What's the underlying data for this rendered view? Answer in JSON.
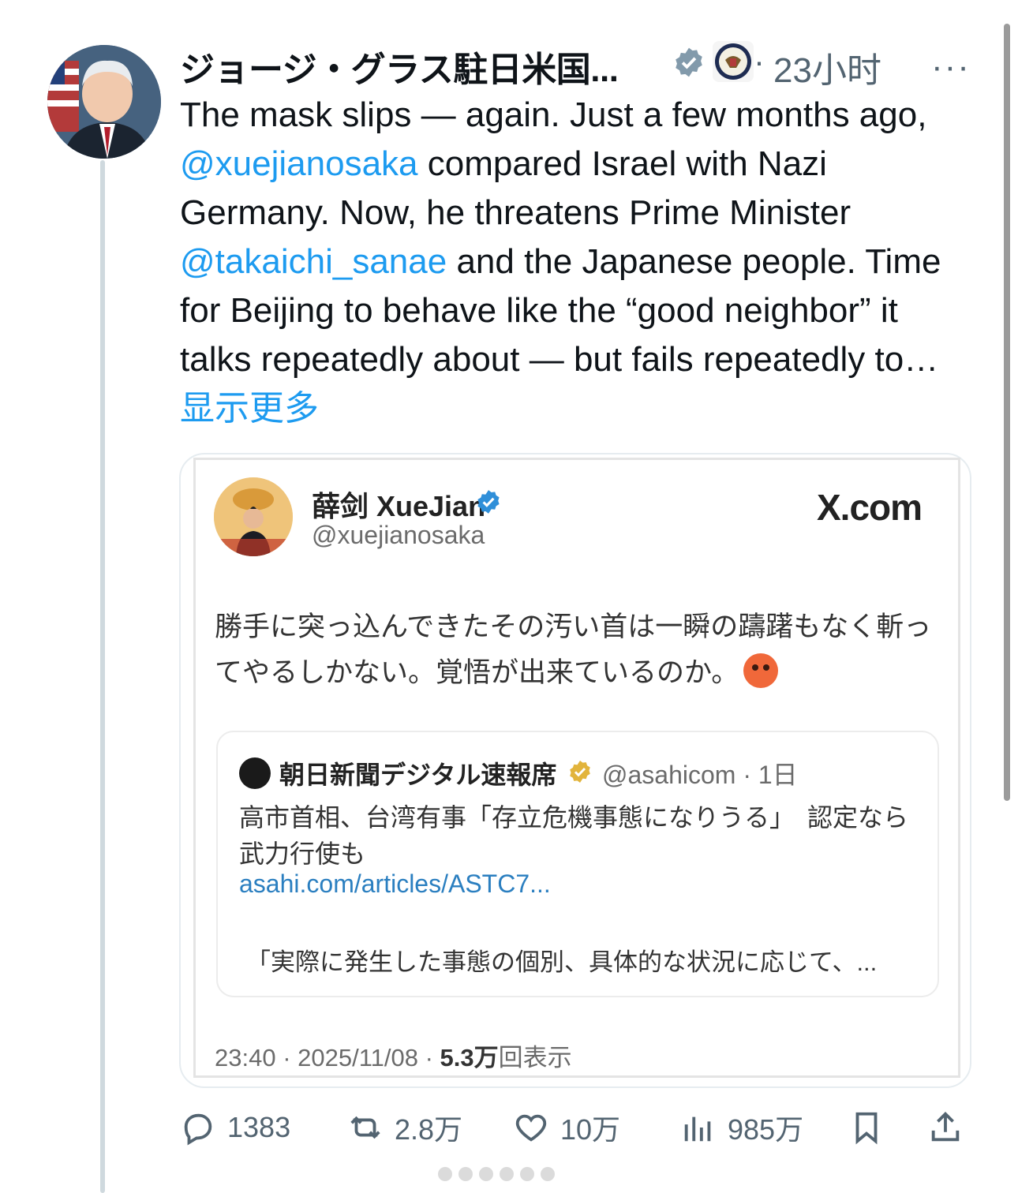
{
  "author": {
    "display_name": "ジョージ・グラス駐日米国...",
    "timestamp": "23小时",
    "more_label": "···"
  },
  "tweet": {
    "text_1": "The mask slips — again. Just a few months ago, ",
    "mention_1": "@xuejianosaka",
    "text_2": " compared Israel with Nazi Germany. Now, he threatens Prime Minister ",
    "mention_2": "@takaichi_sanae",
    "text_3": " and the Japanese people. Time for Beijing to behave like the “good neighbor” it talks repeatedly about — but fails repeatedly to… ",
    "show_more": "显示更多"
  },
  "embedded": {
    "name": "薛剑 XueJian",
    "handle": "@xuejianosaka",
    "site": "X.com",
    "body": "勝手に突っ込んできたその汚い首は一瞬の躊躇もなく斬ってやるしかない。覚悟が出来ているのか。",
    "quote": {
      "name": "朝日新聞デジタル速報席",
      "handle_time": "@asahicom · 1日",
      "body": "高市首相、台湾有事「存立危機事態になりうる」　認定なら武力行使も",
      "link": "asahi.com/articles/ASTC7...",
      "excerpt": "「実際に発生した事態の個別、具体的な状況に応じて、..."
    },
    "footer_time": "23:40 · 2025/11/08 · ",
    "footer_views": "5.3万",
    "footer_views_label": "回表示"
  },
  "actions": {
    "replies": "1383",
    "retweets": "2.8万",
    "likes": "10万",
    "views": "985万"
  },
  "colors": {
    "accent": "#1d9bf0",
    "muted": "#536471",
    "text": "#0f1419"
  }
}
